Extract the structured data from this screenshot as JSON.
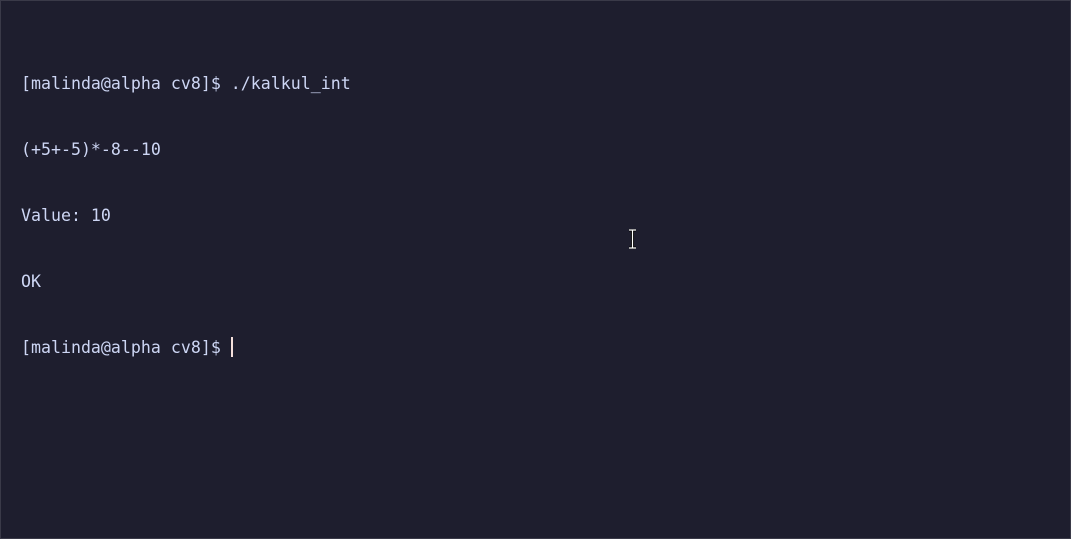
{
  "terminal": {
    "lines": [
      "[malinda@alpha cv8]$ ./kalkul_int",
      "(+5+-5)*-8--10",
      "Value: 10",
      "OK"
    ],
    "prompt": "[malinda@alpha cv8]$ "
  },
  "colors": {
    "background": "#1e1e2e",
    "foreground": "#cdd6f4",
    "cursor": "#f5e0dc"
  },
  "icons": {
    "mouse_pointer": "text-ibeam-icon"
  }
}
